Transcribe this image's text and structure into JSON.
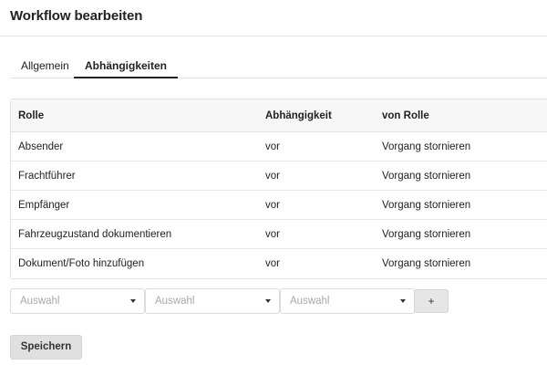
{
  "header": {
    "title": "Workflow bearbeiten"
  },
  "tabs": [
    {
      "label": "Allgemein",
      "active": false
    },
    {
      "label": "Abhängigkeiten",
      "active": true
    }
  ],
  "table": {
    "columns": [
      "Rolle",
      "Abhängigkeit",
      "von Rolle"
    ],
    "rows": [
      [
        "Absender",
        "vor",
        "Vorgang stornieren"
      ],
      [
        "Frachtführer",
        "vor",
        "Vorgang stornieren"
      ],
      [
        "Empfänger",
        "vor",
        "Vorgang stornieren"
      ],
      [
        "Fahrzeugzustand dokumentieren",
        "vor",
        "Vorgang stornieren"
      ],
      [
        "Dokument/Foto hinzufügen",
        "vor",
        "Vorgang stornieren"
      ]
    ]
  },
  "form": {
    "selects": [
      {
        "placeholder": "Auswahl"
      },
      {
        "placeholder": "Auswahl"
      },
      {
        "placeholder": "Auswahl"
      }
    ],
    "add_label": "+"
  },
  "save_label": "Speichern",
  "icons": {
    "select_caret": "caret-down-icon"
  },
  "colors": {
    "header_bg": "#f7f7f7",
    "border": "#e2e2e2",
    "button_bg": "#e0e0e0"
  }
}
